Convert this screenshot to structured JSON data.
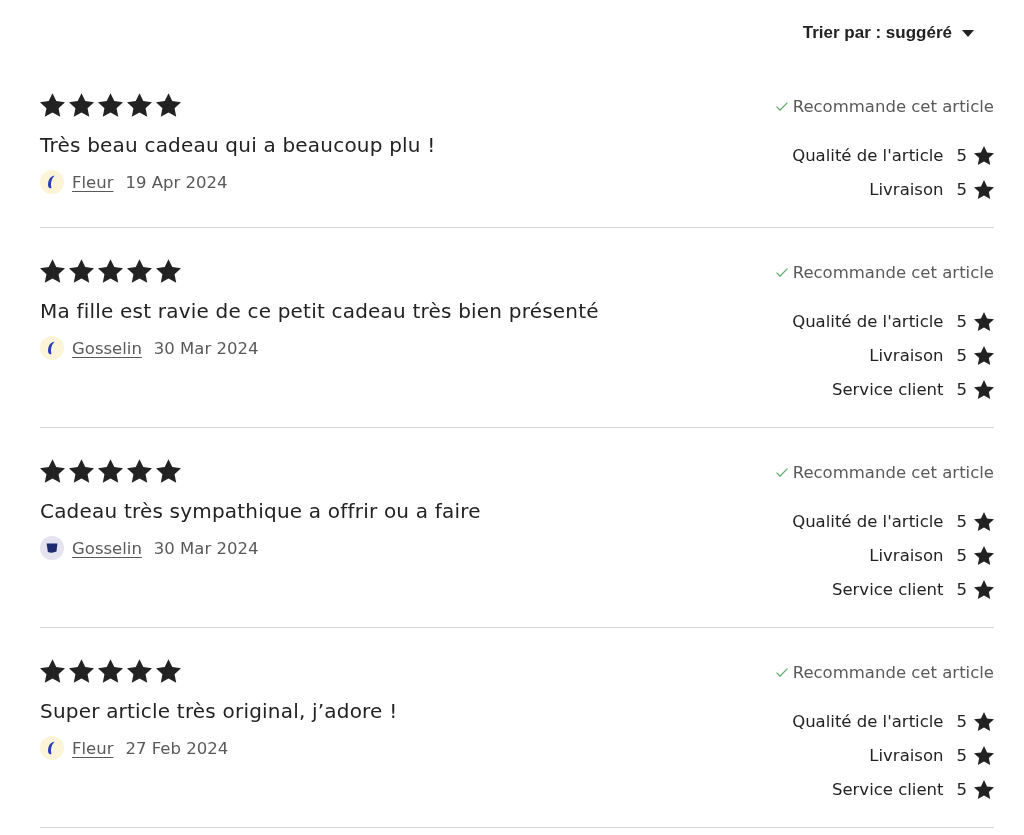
{
  "sort": {
    "label": "Trier par : suggéré"
  },
  "reviews": [
    {
      "stars": 5,
      "text": "Très beau cadeau qui a beaucoup plu !",
      "author": {
        "name": "Fleur",
        "avatar": {
          "kind": "crescent"
        }
      },
      "date": "19 Apr 2024",
      "recommends": true,
      "recommend_label": "Recommande cet article",
      "ratings": [
        {
          "label": "Qualité de l'article",
          "score": "5"
        },
        {
          "label": "Livraison",
          "score": "5"
        }
      ]
    },
    {
      "stars": 5,
      "text": "Ma fille est ravie de ce petit cadeau très bien présenté",
      "author": {
        "name": "Gosselin",
        "avatar": {
          "kind": "crescent"
        }
      },
      "date": "30 Mar 2024",
      "recommends": true,
      "recommend_label": "Recommande cet article",
      "ratings": [
        {
          "label": "Qualité de l'article",
          "score": "5"
        },
        {
          "label": "Livraison",
          "score": "5"
        },
        {
          "label": "Service client",
          "score": "5"
        }
      ]
    },
    {
      "stars": 5,
      "text": "Cadeau très sympathique a offrir ou a faire",
      "author": {
        "name": "Gosselin",
        "avatar": {
          "kind": "square"
        }
      },
      "date": "30 Mar 2024",
      "recommends": true,
      "recommend_label": "Recommande cet article",
      "ratings": [
        {
          "label": "Qualité de l'article",
          "score": "5"
        },
        {
          "label": "Livraison",
          "score": "5"
        },
        {
          "label": "Service client",
          "score": "5"
        }
      ]
    },
    {
      "stars": 5,
      "text": "Super article très original, j’adore !",
      "author": {
        "name": "Fleur",
        "avatar": {
          "kind": "crescent"
        }
      },
      "date": "27 Feb 2024",
      "recommends": true,
      "recommend_label": "Recommande cet article",
      "ratings": [
        {
          "label": "Qualité de l'article",
          "score": "5"
        },
        {
          "label": "Livraison",
          "score": "5"
        },
        {
          "label": "Service client",
          "score": "5"
        }
      ]
    }
  ]
}
